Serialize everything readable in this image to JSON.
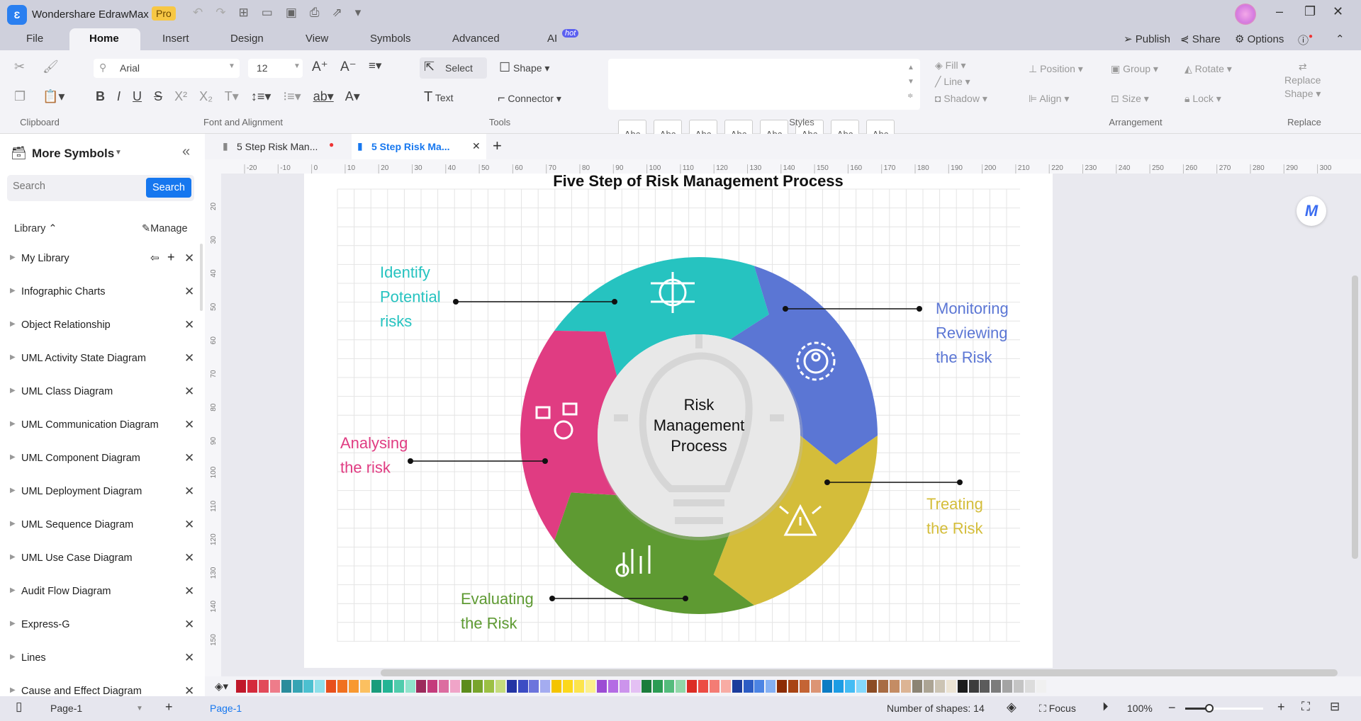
{
  "app": {
    "title": "Wondershare EdrawMax",
    "badge": "Pro"
  },
  "menu": {
    "tabs": [
      "File",
      "Home",
      "Insert",
      "Design",
      "View",
      "Symbols",
      "Advanced",
      "AI"
    ],
    "active": "Home",
    "ai_badge": "hot",
    "publish": "Publish",
    "share": "Share",
    "options": "Options"
  },
  "ribbon": {
    "font": "Arial",
    "size": "12",
    "select": "Select",
    "shape": "Shape",
    "text": "Text",
    "connector": "Connector",
    "styles": [
      "Abc",
      "Abc",
      "Abc",
      "Abc",
      "Abc",
      "Abc",
      "Abc",
      "Abc"
    ],
    "fill": "Fill",
    "line": "Line",
    "shadow": "Shadow",
    "position": "Position",
    "group": "Group",
    "rotate": "Rotate",
    "align": "Align",
    "size_btn": "Size",
    "lock": "Lock",
    "replace_shape_1": "Replace",
    "replace_shape_2": "Shape",
    "groups": {
      "clipboard": "Clipboard",
      "font": "Font and Alignment",
      "tools": "Tools",
      "styles": "Styles",
      "arrangement": "Arrangement",
      "replace": "Replace"
    }
  },
  "sidebar": {
    "title": "More Symbols",
    "search_placeholder": "Search",
    "search_button": "Search",
    "library": "Library",
    "manage": "Manage",
    "items": [
      "My Library",
      "Infographic Charts",
      "Object Relationship",
      "UML Activity State Diagram",
      "UML Class Diagram",
      "UML Communication Diagram",
      "UML Component Diagram",
      "UML Deployment Diagram",
      "UML Sequence Diagram",
      "UML Use Case Diagram",
      "Audit Flow Diagram",
      "Express-G",
      "Lines",
      "Cause and Effect Diagram"
    ]
  },
  "doc_tabs": [
    {
      "label": "5 Step Risk Man...",
      "unsaved": true
    },
    {
      "label": "5 Step Risk Ma...",
      "active": true
    }
  ],
  "ruler": {
    "h": [
      "-20",
      "-10",
      "0",
      "10",
      "20",
      "30",
      "40",
      "50",
      "60",
      "70",
      "80",
      "90",
      "100",
      "110",
      "120",
      "130",
      "140",
      "150",
      "160",
      "170",
      "180",
      "190",
      "200",
      "210",
      "220",
      "230",
      "240",
      "250",
      "260",
      "270",
      "280",
      "290",
      "300"
    ],
    "v": [
      "20",
      "30",
      "40",
      "50",
      "60",
      "70",
      "80",
      "90",
      "100",
      "110",
      "120",
      "130",
      "140",
      "150"
    ]
  },
  "diagram": {
    "title": "Five Step of Risk Management Process",
    "center": [
      "Risk",
      "Management",
      "Process"
    ],
    "steps": [
      {
        "lines": [
          "Identify",
          "Potential",
          "risks"
        ],
        "color": "#26c3c0"
      },
      {
        "lines": [
          "Monitoring",
          "Reviewing",
          "the Risk"
        ],
        "color": "#5b76d4"
      },
      {
        "lines": [
          "Treating",
          "the Risk"
        ],
        "color": "#d4bd3a"
      },
      {
        "lines": [
          "Evaluating",
          "the Risk"
        ],
        "color": "#5e9a32"
      },
      {
        "lines": [
          "Analysing",
          "the risk"
        ],
        "color": "#e03c82"
      }
    ]
  },
  "palette": [
    "#c0182a",
    "#d42a3c",
    "#e24a5a",
    "#ee7c8a",
    "#2a8c9c",
    "#36a4b4",
    "#4cc0d0",
    "#8ee0ea",
    "#e8501c",
    "#f07020",
    "#f89830",
    "#fcc060",
    "#1a9c7c",
    "#24b494",
    "#50ccac",
    "#90e4cc",
    "#9c2a5c",
    "#c43c7c",
    "#dc6ca0",
    "#f0a4c8",
    "#5c8c1c",
    "#78a42c",
    "#9cc044",
    "#c4dc7c",
    "#2434a4",
    "#3c4cc4",
    "#6c74dc",
    "#a4acf0",
    "#f4c400",
    "#fcd81c",
    "#fce44c",
    "#fcf08c",
    "#9c4cd4",
    "#b46ce4",
    "#cc94ec",
    "#e4c0f4",
    "#1c7c3c",
    "#2c9c54",
    "#54bc7c",
    "#90d8a8",
    "#dc2c24",
    "#ec4c44",
    "#f47c74",
    "#f8aca4",
    "#1c3c9c",
    "#2c5cc4",
    "#4c84e4",
    "#84b0f4",
    "#8c2c04",
    "#a84414",
    "#c46434",
    "#dc9474",
    "#0c7cc4",
    "#1c9ce4",
    "#44bcf4",
    "#84d8fc",
    "#8c4c24",
    "#a86c44",
    "#c48c64",
    "#dcb494",
    "#8c8474",
    "#aca494",
    "#ccc4b4",
    "#ece4d4",
    "#1c1c1c",
    "#3c3c3c",
    "#5c5c5c",
    "#7c7c7c",
    "#a4a4a4",
    "#c4c4c4",
    "#dcdcdc",
    "#f0f0f0"
  ],
  "status": {
    "page_select": "Page-1",
    "page_tab": "Page-1",
    "shapes": "Number of shapes: 14",
    "focus": "Focus",
    "zoom": "100%"
  }
}
